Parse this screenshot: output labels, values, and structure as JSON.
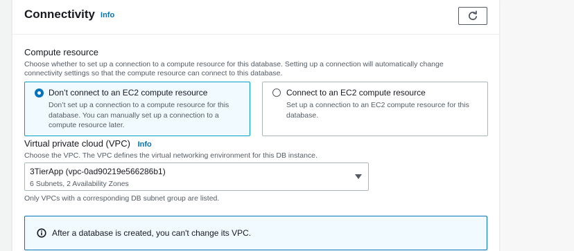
{
  "colors": {
    "accent": "#0073bb",
    "selected_border": "#00a1c9",
    "selected_bg": "#f1faff",
    "text_primary": "#16191f",
    "text_secondary": "#545b64"
  },
  "header": {
    "title": "Connectivity",
    "info_label": "Info",
    "refresh_icon": "refresh-icon"
  },
  "compute": {
    "label": "Compute resource",
    "description_line1": "Choose whether to set up a connection to a compute resource for this database. Setting up a connection will automatically change",
    "description_line2": "connectivity settings so that the compute resource can connect to this database.",
    "options": [
      {
        "title": "Don’t connect to an EC2 compute resource",
        "desc_line1": "Don’t set up a connection to a compute resource for this",
        "desc_line2": "database. You can manually set up a connection to a",
        "desc_line3": "compute resource later.",
        "selected": true
      },
      {
        "title": "Connect to an EC2 compute resource",
        "desc_line1": "Set up a connection to an EC2 compute resource for this",
        "desc_line2": "database.",
        "selected": false
      }
    ]
  },
  "vpc": {
    "label": "Virtual private cloud (VPC)",
    "info_label": "Info",
    "description": "Choose the VPC. The VPC defines the virtual networking environment for this DB instance.",
    "selected_value": "3TierApp (vpc-0ad90219e566286b1)",
    "selected_detail": "6 Subnets, 2 Availability Zones",
    "hint": "Only VPCs with a corresponding DB subnet group are listed."
  },
  "alert": {
    "icon": "info-circle-icon",
    "message": "After a database is created, you can't change its VPC."
  }
}
